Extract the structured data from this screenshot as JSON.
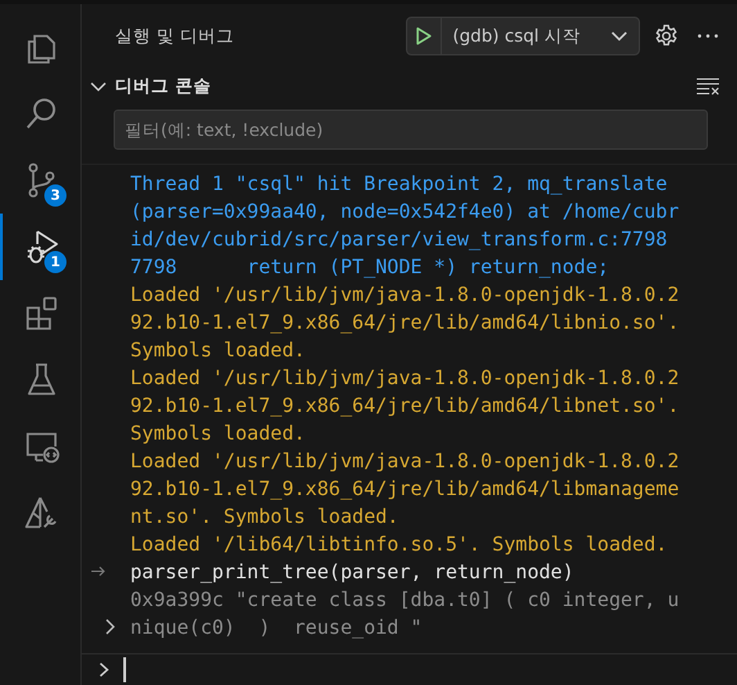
{
  "activity_bar": {
    "items": [
      {
        "kind": "files",
        "selected": false
      },
      {
        "kind": "search",
        "selected": false
      },
      {
        "kind": "source-control",
        "selected": false,
        "badge": "3"
      },
      {
        "kind": "run-debug",
        "selected": true,
        "badge": "1"
      },
      {
        "kind": "extensions",
        "selected": false
      },
      {
        "kind": "testing",
        "selected": false
      },
      {
        "kind": "remote",
        "selected": false
      },
      {
        "kind": "tools",
        "selected": false
      }
    ]
  },
  "panel": {
    "title": "실행 및 디버그",
    "launch_config": "(gdb) csql 시작"
  },
  "console": {
    "title": "디버그 콘솔",
    "expanded": true,
    "filter_placeholder": "필터(예: text, !exclude)",
    "messages": [
      {
        "kind": "output",
        "color": "#3b9cf0",
        "text": "Thread 1 \"csql\" hit Breakpoint 2, mq_translate (parser=0x99aa40, node=0x542f4e0) at /home/cubrid/dev/cubrid/src/parser/view_transform.c:7798"
      },
      {
        "kind": "output",
        "color": "#3b9cf0",
        "text": "7798      return (PT_NODE *) return_node;"
      },
      {
        "kind": "output",
        "color": "#d7a832",
        "text": "Loaded '/usr/lib/jvm/java-1.8.0-openjdk-1.8.0.292.b10-1.el7_9.x86_64/jre/lib/amd64/libnio.so'. Symbols loaded."
      },
      {
        "kind": "output",
        "color": "#d7a832",
        "text": "Loaded '/usr/lib/jvm/java-1.8.0-openjdk-1.8.0.292.b10-1.el7_9.x86_64/jre/lib/amd64/libnet.so'. Symbols loaded."
      },
      {
        "kind": "output",
        "color": "#d7a832",
        "text": "Loaded '/usr/lib/jvm/java-1.8.0-openjdk-1.8.0.292.b10-1.el7_9.x86_64/jre/lib/amd64/libmanagement.so'. Symbols loaded."
      },
      {
        "kind": "output",
        "color": "#d7a832",
        "text": "Loaded '/lib64/libtinfo.so.5'. Symbols loaded."
      },
      {
        "kind": "input",
        "text": "parser_print_tree(parser, return_node)"
      },
      {
        "kind": "result",
        "expanded": false,
        "text": "0x9a399c \"create class [dba.t0] ( c0 integer, unique(c0)  )  reuse_oid \""
      }
    ]
  }
}
